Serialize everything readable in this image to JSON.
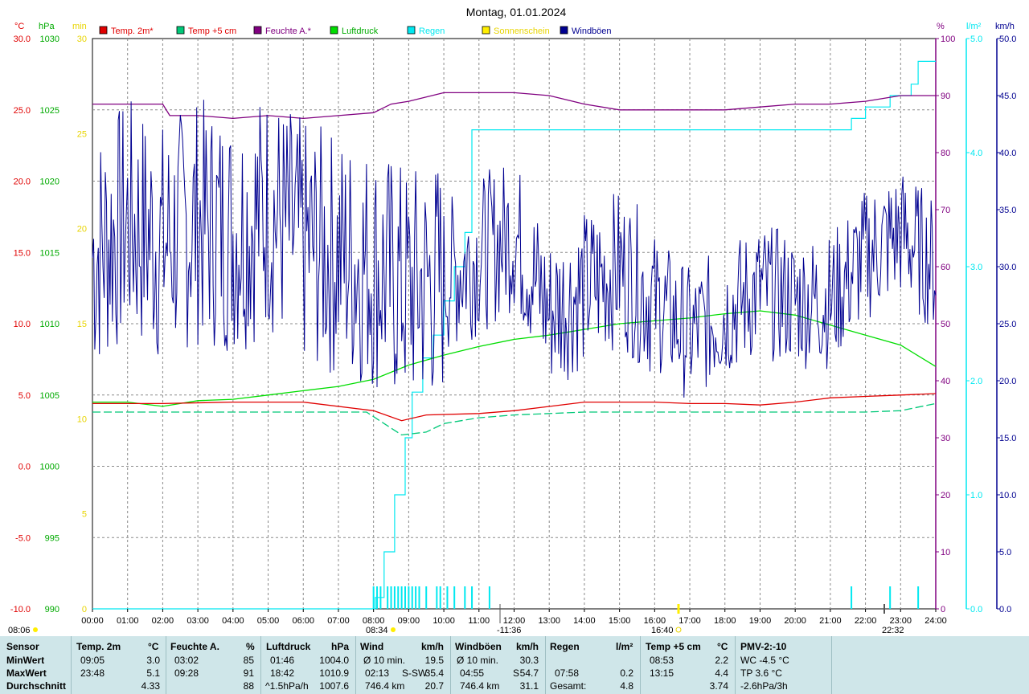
{
  "title": "Montag, 01.01.2024",
  "axes_units": {
    "temp": "°C",
    "pressure": "hPa",
    "sun": "min",
    "humidity": "%",
    "rain": "l/m²",
    "wind": "km/h"
  },
  "legend": [
    {
      "label": "Temp. 2m*",
      "color": "#e00000",
      "text_color": "#e00000"
    },
    {
      "label": "Temp +5 cm",
      "color": "#00c878",
      "text_color": "#e00000"
    },
    {
      "label": "Feuchte A.*",
      "color": "#800080",
      "text_color": "#800080"
    },
    {
      "label": "Luftdruck",
      "color": "#00dd00",
      "text_color": "#00aa00"
    },
    {
      "label": "Regen",
      "color": "#00e8f0",
      "text_color": "#00e8f0"
    },
    {
      "label": "Sonnenschein",
      "color": "#ffee00",
      "text_color": "#e8d400"
    },
    {
      "label": "Windböen",
      "color": "#000090",
      "text_color": "#000090"
    }
  ],
  "markers": {
    "sunrise": "08:34",
    "noon": "-11:36",
    "sunset": "16:40",
    "moon": "22:32",
    "left_time": "08:06"
  },
  "chart_data": {
    "type": "line",
    "x_label": "time",
    "x_ticks": [
      "00:00",
      "01:00",
      "02:00",
      "03:00",
      "04:00",
      "05:00",
      "06:00",
      "07:00",
      "08:00",
      "09:00",
      "10:00",
      "11:00",
      "12:00",
      "13:00",
      "14:00",
      "15:00",
      "16:00",
      "17:00",
      "18:00",
      "19:00",
      "20:00",
      "21:00",
      "22:00",
      "23:00",
      "24:00"
    ],
    "axes": {
      "temp": {
        "ticks": [
          "30.0",
          "25.0",
          "20.0",
          "15.0",
          "10.0",
          "5.0",
          "0.0",
          "-5.0",
          "-10.0"
        ],
        "range": [
          -10,
          30
        ]
      },
      "pressure": {
        "ticks": [
          "1030",
          "1025",
          "1020",
          "1015",
          "1010",
          "1005",
          "1000",
          "995",
          "990"
        ],
        "range": [
          990,
          1030
        ]
      },
      "sun": {
        "ticks": [
          "30",
          "25",
          "20",
          "15",
          "10",
          "5",
          "0"
        ],
        "range": [
          0,
          30
        ]
      },
      "humidity": {
        "ticks": [
          "100",
          "90",
          "80",
          "70",
          "60",
          "50",
          "40",
          "30",
          "20",
          "10",
          "0"
        ],
        "range": [
          0,
          100
        ]
      },
      "rain": {
        "ticks": [
          "5.0",
          "4.0",
          "3.0",
          "2.0",
          "1.0",
          "0.0"
        ],
        "range": [
          0,
          5
        ]
      },
      "wind": {
        "ticks": [
          "50.0",
          "45.0",
          "40.0",
          "35.0",
          "30.0",
          "25.0",
          "20.0",
          "15.0",
          "10.0",
          "5.0",
          "0.0"
        ],
        "range": [
          0,
          50
        ]
      }
    },
    "series": [
      {
        "name": "Temp. 2m*",
        "axis": "temp",
        "color": "#e00000",
        "x": [
          0,
          2,
          4,
          6,
          8,
          8.8,
          9.5,
          11,
          12,
          13,
          14,
          15,
          16,
          17,
          18,
          19,
          20,
          21,
          22,
          23,
          24
        ],
        "y": [
          4.4,
          4.4,
          4.5,
          4.5,
          3.9,
          3.2,
          3.6,
          3.7,
          3.9,
          4.2,
          4.5,
          4.5,
          4.5,
          4.4,
          4.4,
          4.3,
          4.5,
          4.8,
          4.9,
          5.0,
          5.1
        ]
      },
      {
        "name": "Temp +5 cm",
        "axis": "temp",
        "color": "#00c878",
        "x": [
          0,
          2,
          4,
          6,
          7,
          7.8,
          8.3,
          8.8,
          9.5,
          10,
          11,
          12,
          14,
          16,
          18,
          20,
          22,
          23,
          24
        ],
        "y": [
          3.8,
          3.8,
          3.8,
          3.8,
          3.8,
          3.8,
          3.0,
          2.2,
          2.4,
          3.0,
          3.4,
          3.6,
          3.8,
          3.8,
          3.8,
          3.8,
          3.8,
          3.9,
          4.4
        ]
      },
      {
        "name": "Feuchte A.*",
        "axis": "humidity",
        "color": "#800080",
        "x": [
          0,
          2,
          2.2,
          3,
          4,
          5,
          6,
          7,
          8,
          8.5,
          9,
          10,
          11,
          12,
          13,
          14,
          15,
          16,
          17,
          18,
          19,
          20,
          21,
          22,
          23,
          24
        ],
        "y": [
          88.5,
          88.5,
          86.5,
          86.5,
          86,
          86.5,
          86,
          86.5,
          87,
          88.5,
          89,
          90.5,
          90.5,
          90.5,
          90,
          88.5,
          87.5,
          87.5,
          87.5,
          87.5,
          88,
          88.5,
          88.5,
          89,
          90,
          90
        ]
      },
      {
        "name": "Luftdruck",
        "axis": "pressure",
        "color": "#00dd00",
        "x": [
          0,
          1,
          2,
          3,
          4,
          5,
          6,
          7,
          8,
          9,
          10,
          11,
          12,
          13,
          14,
          15,
          16,
          17,
          18,
          19,
          20,
          21,
          22,
          23,
          24
        ],
        "y": [
          1004.5,
          1004.5,
          1004.2,
          1004.6,
          1004.7,
          1005.0,
          1005.3,
          1005.6,
          1006.1,
          1007.1,
          1007.8,
          1008.4,
          1008.9,
          1009.2,
          1009.6,
          1010.0,
          1010.2,
          1010.4,
          1010.7,
          1010.9,
          1010.6,
          1009.9,
          1009.2,
          1008.5,
          1007.0
        ]
      },
      {
        "name": "Regen",
        "axis": "rain",
        "color": "#00e8f0",
        "x": [
          0,
          8,
          8.05,
          8.3,
          8.6,
          8.9,
          9.1,
          9.4,
          9.7,
          10,
          10.3,
          10.6,
          10.8,
          11.3,
          13,
          15,
          17,
          19,
          21,
          21.6,
          22,
          22.7,
          23.3,
          23.5,
          24
        ],
        "y": [
          0,
          0,
          0.1,
          0.5,
          1.0,
          1.5,
          1.9,
          2.2,
          2.4,
          2.7,
          3.0,
          3.3,
          4.2,
          4.2,
          4.2,
          4.2,
          4.2,
          4.2,
          4.2,
          4.3,
          4.4,
          4.5,
          4.6,
          4.8,
          4.8
        ]
      },
      {
        "name": "Windböen",
        "axis": "wind",
        "color": "#000090",
        "x": [
          0,
          1,
          2,
          3,
          4,
          5,
          6,
          7,
          8,
          9,
          10,
          11,
          12,
          13,
          14,
          15,
          16,
          17,
          18,
          19,
          20,
          21,
          22,
          23,
          24
        ],
        "y": [
          31,
          34,
          32,
          34,
          33,
          35,
          32,
          31,
          30,
          28,
          29,
          31,
          33,
          26,
          28,
          30,
          27,
          24,
          26,
          28,
          27,
          27,
          31,
          33,
          30
        ]
      }
    ]
  },
  "stats": {
    "col0": {
      "title": "Sensor",
      "rows": [
        "MinWert",
        "MaxWert",
        "Durchschnitt"
      ]
    },
    "col1": {
      "title": "Temp. 2m",
      "unit": "°C",
      "min_time": "09:05",
      "min_val": "3.0",
      "max_time": "23:48",
      "max_val": "5.1",
      "avg": "4.33"
    },
    "col2": {
      "title": "Feuchte A.",
      "unit": "%",
      "min_time": "03:02",
      "min_val": "85",
      "max_time": "09:28",
      "max_val": "91",
      "avg": "88"
    },
    "col3": {
      "title": "Luftdruck",
      "unit": "hPa",
      "min_time": "01:46",
      "min_val": "1004.0",
      "max_time": "18:42",
      "max_val": "1010.9",
      "avg_label": "^1.5hPa/h",
      "avg": "1007.6"
    },
    "col4": {
      "title": "Wind",
      "unit": "km/h",
      "r1_label": "Ø 10 min.",
      "r1_val": "19.5",
      "r2_label": "02:13",
      "r2_dir": "S-SW",
      "r2_val": "35.4",
      "r3_label": "746.4 km",
      "r3_val": "20.7"
    },
    "col5": {
      "title": "Windböen",
      "unit": "km/h",
      "r1_label": "Ø 10 min.",
      "r1_val": "30.3",
      "r2_label": "04:55",
      "r2_dir": "S",
      "r2_val": "54.7",
      "r3_label": "746.4 km",
      "r3_val": "31.1"
    },
    "col6": {
      "title": "Regen",
      "unit": "l/m²",
      "r2_label": "07:58",
      "r2_val": "0.2",
      "r3_label": "Gesamt:",
      "r3_val": "4.8"
    },
    "col7": {
      "title": "Temp +5 cm",
      "unit": "°C",
      "min_time": "08:53",
      "min_val": "2.2",
      "max_time": "13:15",
      "max_val": "4.4",
      "avg": "3.74"
    },
    "col8": {
      "title": "PMV-2:-10",
      "r1": "WC -4.5 °C",
      "r2": "TP 3.6 °C",
      "r3": "-2.6hPa/3h"
    }
  }
}
